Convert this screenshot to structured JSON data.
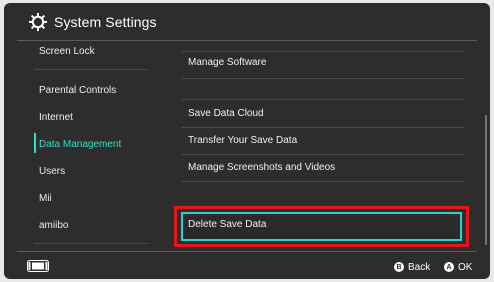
{
  "header": {
    "title": "System Settings",
    "icon": "gear-icon"
  },
  "sidebar": {
    "items": [
      {
        "label": "Screen Lock"
      },
      {
        "label": "Parental Controls"
      },
      {
        "label": "Internet"
      },
      {
        "label": "Data Management",
        "selected": true
      },
      {
        "label": "Users"
      },
      {
        "label": "Mii"
      },
      {
        "label": "amiibo"
      }
    ]
  },
  "main": {
    "items": [
      {
        "label": "Manage Software"
      },
      {
        "label": "Save Data Cloud"
      },
      {
        "label": "Transfer Your Save Data"
      },
      {
        "label": "Manage Screenshots and Videos"
      },
      {
        "label": "Delete Save Data",
        "focused": true
      }
    ]
  },
  "footer": {
    "back": {
      "glyph": "B",
      "label": "Back"
    },
    "ok": {
      "glyph": "A",
      "label": "OK"
    }
  },
  "colors": {
    "accent": "#2fe0c6",
    "highlight_red": "#e8141c",
    "background": "#2d2d2d"
  }
}
